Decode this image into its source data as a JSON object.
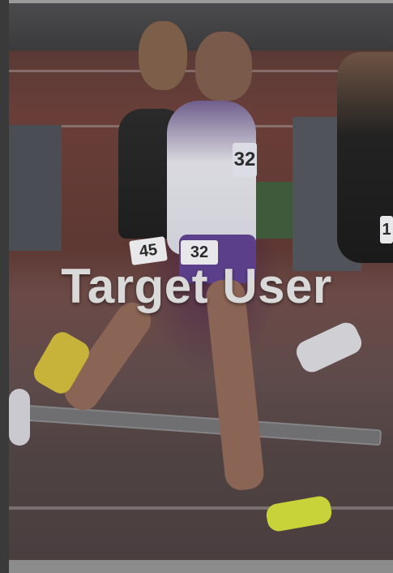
{
  "card": {
    "title": "Target User"
  },
  "photo": {
    "bib_left": "45",
    "bib_center": "32",
    "bib_chest": "32",
    "bib_right": "1"
  },
  "colors": {
    "overlay_text": "#d9d9d9",
    "bottom_bar": "#8c8c8c",
    "accent_shoe": "#c8d33a"
  }
}
